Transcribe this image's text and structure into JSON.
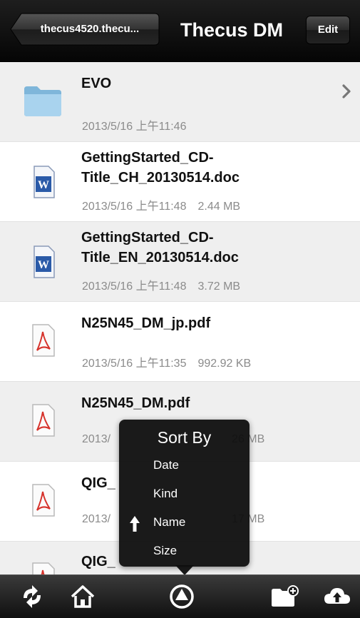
{
  "navbar": {
    "back_label": "thecus4520.thecu...",
    "title": "Thecus DM",
    "edit_label": "Edit"
  },
  "files": [
    {
      "name": "EVO",
      "date": "2013/5/16 上午11:46",
      "size": "",
      "type": "folder"
    },
    {
      "name": "GettingStarted_CD-Title_CH_20130514.doc",
      "date": "2013/5/16 上午11:48",
      "size": "2.44 MB",
      "type": "doc"
    },
    {
      "name": "GettingStarted_CD-Title_EN_20130514.doc",
      "date": "2013/5/16 上午11:48",
      "size": "3.72 MB",
      "type": "doc"
    },
    {
      "name": "N25N45_DM_jp.pdf",
      "date": "2013/5/16 上午11:35",
      "size": "992.92 KB",
      "type": "pdf"
    },
    {
      "name": "N25N45_DM.pdf",
      "date": "2013/",
      "size": "26 MB",
      "type": "pdf"
    },
    {
      "name": "QIG_",
      "date": "2013/",
      "size": "17 MB",
      "type": "pdf"
    },
    {
      "name": "QIG_",
      "date": "",
      "size": "",
      "type": "pdf"
    }
  ],
  "sort_popover": {
    "title": "Sort By",
    "options": [
      "Date",
      "Kind",
      "Name",
      "Size"
    ],
    "selected": "Name",
    "direction_icon": "arrow-up-icon"
  },
  "toolbar": {
    "icons": [
      "refresh-icon",
      "home-icon",
      "sort-icon",
      "new-folder-icon",
      "upload-cloud-icon"
    ]
  },
  "colors": {
    "navbar": "#0d0d0d",
    "row_alt": "#efefef",
    "meta_text": "#8b8b8b",
    "folder": "#8fc3e4",
    "pdf": "#d6322b",
    "doc": "#2a5aa8"
  }
}
